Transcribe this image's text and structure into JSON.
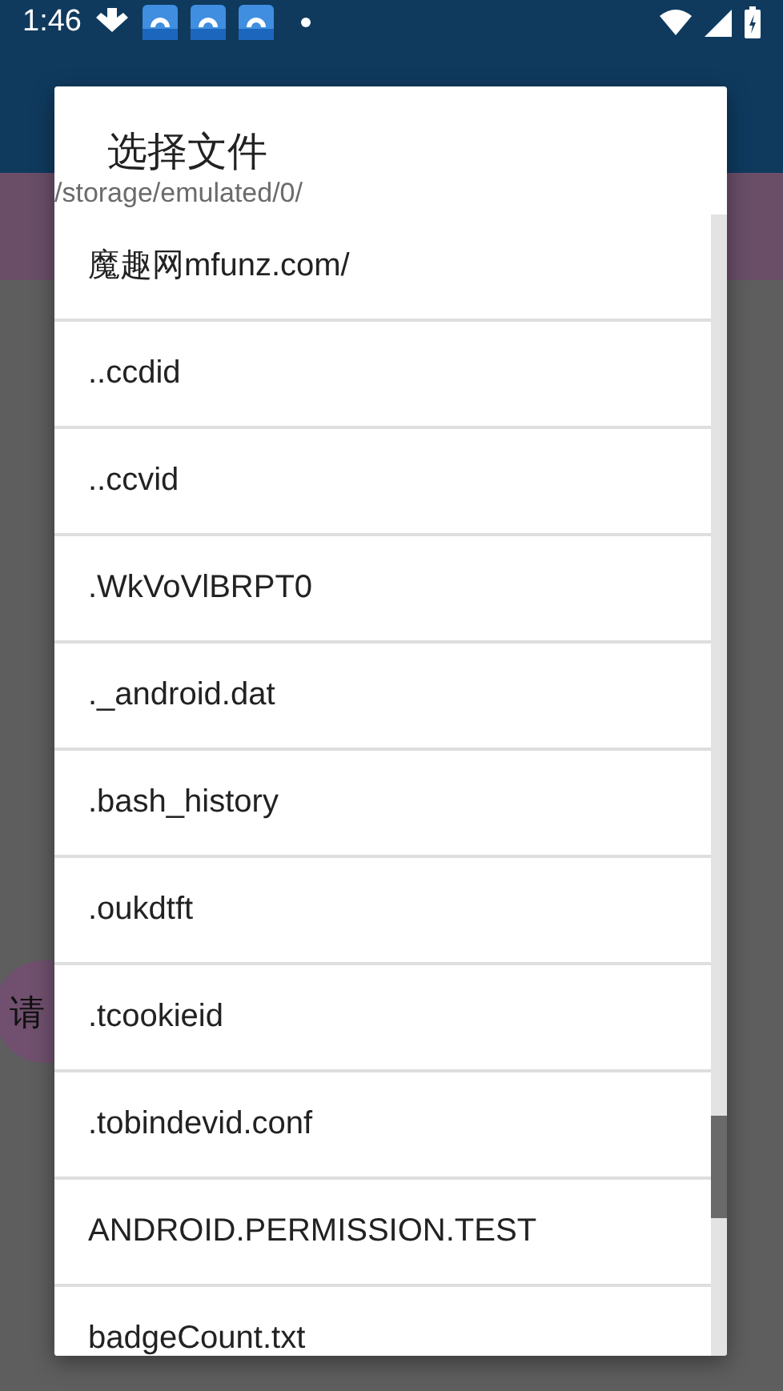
{
  "status_bar": {
    "time": "1:46"
  },
  "background": {
    "button_label": "请"
  },
  "dialog": {
    "title": "选择文件",
    "path": "/storage/emulated/0/",
    "items": [
      {
        "name": "魔趣网mfunz.com/"
      },
      {
        "name": "..ccdid"
      },
      {
        "name": "..ccvid"
      },
      {
        "name": ".WkVoVlBRPT0"
      },
      {
        "name": "._android.dat"
      },
      {
        "name": ".bash_history"
      },
      {
        "name": ".oukdtft"
      },
      {
        "name": ".tcookieid"
      },
      {
        "name": ".tobindevid.conf"
      },
      {
        "name": "ANDROID.PERMISSION.TEST"
      },
      {
        "name": "badgeCount.txt"
      }
    ]
  }
}
